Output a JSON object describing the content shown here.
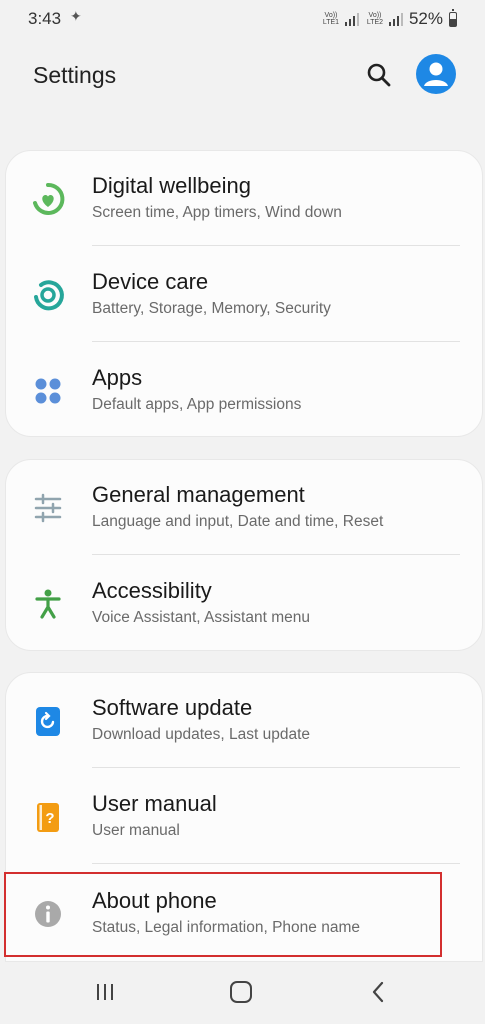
{
  "status": {
    "time": "3:43",
    "battery": "52%",
    "sim1": "Vo)) LTE1",
    "sim2": "Vo)) LTE2"
  },
  "header": {
    "title": "Settings"
  },
  "groups": [
    [
      {
        "title": "Digital wellbeing",
        "subtitle": "Screen time, App timers, Wind down",
        "icon": "digital-wellbeing-icon"
      },
      {
        "title": "Device care",
        "subtitle": "Battery, Storage, Memory, Security",
        "icon": "device-care-icon"
      },
      {
        "title": "Apps",
        "subtitle": "Default apps, App permissions",
        "icon": "apps-icon"
      }
    ],
    [
      {
        "title": "General management",
        "subtitle": "Language and input, Date and time, Reset",
        "icon": "sliders-icon"
      },
      {
        "title": "Accessibility",
        "subtitle": "Voice Assistant, Assistant menu",
        "icon": "accessibility-icon"
      }
    ],
    [
      {
        "title": "Software update",
        "subtitle": "Download updates, Last update",
        "icon": "software-update-icon"
      },
      {
        "title": "User manual",
        "subtitle": "User manual",
        "icon": "user-manual-icon"
      },
      {
        "title": "About phone",
        "subtitle": "Status, Legal information, Phone name",
        "icon": "info-icon"
      }
    ]
  ],
  "colors": {
    "wellbeing": "#5cb85c",
    "device_care": "#26a69a",
    "apps": "#5b8fd9",
    "general": "#90a4ae",
    "accessibility": "#43a047",
    "software_update": "#1e88e5",
    "user_manual": "#f39c12",
    "about": "#9e9e9e",
    "highlight": "#d32f2f"
  }
}
